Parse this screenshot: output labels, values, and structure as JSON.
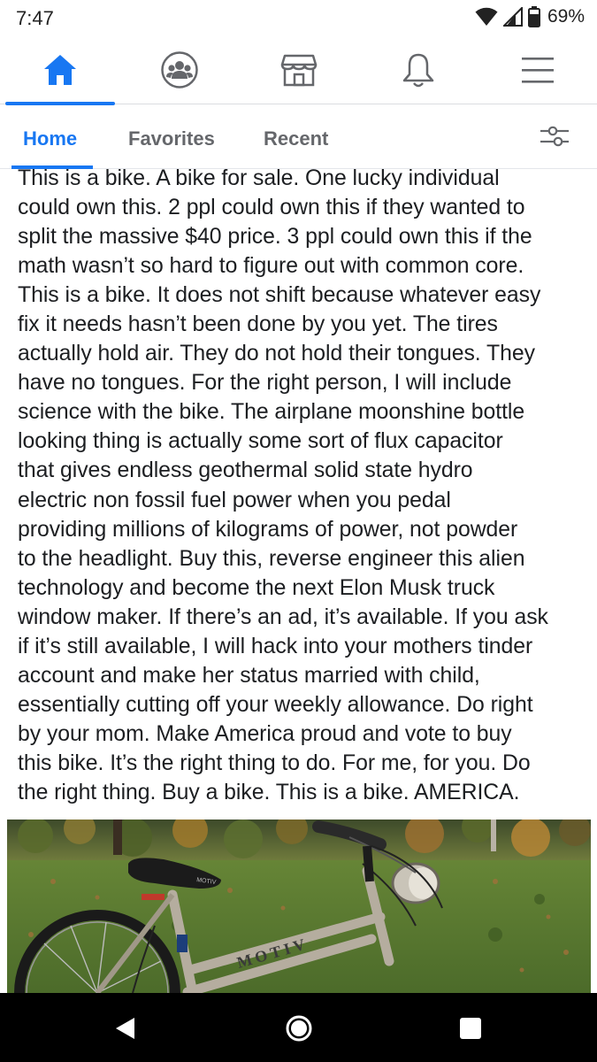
{
  "status_bar": {
    "time": "7:47",
    "battery_percent": "69%",
    "icons": [
      "wifi-icon",
      "cell-signal-icon",
      "battery-icon"
    ]
  },
  "main_nav": {
    "items": [
      {
        "name": "home",
        "icon": "home-icon",
        "active": true
      },
      {
        "name": "groups",
        "icon": "groups-icon",
        "active": false
      },
      {
        "name": "marketplace",
        "icon": "marketplace-icon",
        "active": false
      },
      {
        "name": "notifications",
        "icon": "bell-icon",
        "active": false
      },
      {
        "name": "menu",
        "icon": "menu-icon",
        "active": false
      }
    ],
    "accent_color": "#1877f2"
  },
  "feed_tabs": {
    "tabs": [
      "Home",
      "Favorites",
      "Recent"
    ],
    "active": "Home",
    "filter_icon": "filter-sliders-icon"
  },
  "post": {
    "text": "This is a bike. A bike for sale. One lucky individual\ncould own this. 2 ppl could own this if they wanted to\nsplit the massive $40 price. 3 ppl could own this if the\nmath wasn’t so hard to figure out with common core.\nThis is a bike. It does not shift because whatever easy\nfix it needs hasn’t been done by you yet. The tires\nactually hold air. They do not hold their tongues. They\nhave no tongues. For the right person, I will include\nscience with the bike. The airplane moonshine bottle\nlooking thing is actually some sort of flux capacitor\nthat gives endless geothermal solid state hydro\nelectric non fossil fuel power when you pedal\nproviding millions of kilograms of power, not powder\nto the headlight. Buy this, reverse engineer this alien\ntechnology and become the next Elon Musk truck\nwindow maker. If there’s an ad, it’s available. If you ask\nif it’s still available, I will hack into your mothers tinder\naccount and make her status married with child,\nessentially cutting off your weekly allowance. Do right\nby your mom. Make America proud and vote to buy\nthis bike. It’s the right thing to do. For me, for you. Do\nthe right thing. Buy a bike. This is a bike. AMERICA.",
    "photo": {
      "subject": "bike-photo",
      "frame_lettering": "MOTIV",
      "saddle_lettering": "MOTIV"
    }
  },
  "android_nav": {
    "buttons": [
      "back-icon",
      "home-circle-icon",
      "recents-icon"
    ]
  }
}
